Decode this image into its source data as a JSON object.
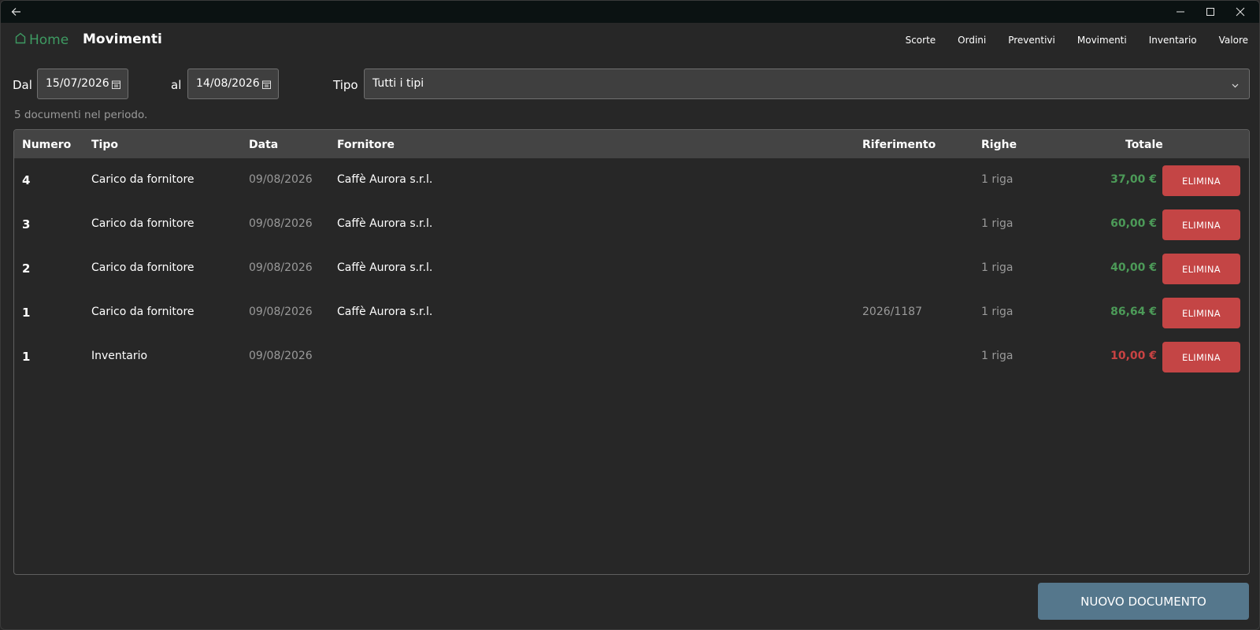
{
  "titlebar": {
    "back_icon": "arrow-left-icon",
    "minimize_icon": "minimize-icon",
    "maximize_icon": "maximize-icon",
    "close_icon": "close-icon"
  },
  "nav": {
    "home_label": "Home",
    "home_icon": "home-icon",
    "page_title": "Movimenti",
    "items": [
      "Scorte",
      "Ordini",
      "Preventivi",
      "Movimenti",
      "Inventario",
      "Valore"
    ]
  },
  "filters": {
    "from_label": "Dal",
    "from_value": "15/07/2026",
    "to_label": "al",
    "to_value": "14/08/2026",
    "type_label": "Tipo",
    "type_value": "Tutti i tipi"
  },
  "summary": "5 documenti nel periodo.",
  "table": {
    "headers": {
      "numero": "Numero",
      "tipo": "Tipo",
      "data": "Data",
      "fornitore": "Fornitore",
      "riferimento": "Riferimento",
      "righe": "Righe",
      "totale": "Totale"
    },
    "delete_label": "ELIMINA",
    "rows": [
      {
        "numero": "4",
        "tipo": "Carico da fornitore",
        "data": "09/08/2026",
        "fornitore": "Caffè Aurora s.r.l.",
        "riferimento": "",
        "righe": "1 riga",
        "totale": "37,00 €",
        "totale_color": "#4c9a58"
      },
      {
        "numero": "3",
        "tipo": "Carico da fornitore",
        "data": "09/08/2026",
        "fornitore": "Caffè Aurora s.r.l.",
        "riferimento": "",
        "righe": "1 riga",
        "totale": "60,00 €",
        "totale_color": "#4c9a58"
      },
      {
        "numero": "2",
        "tipo": "Carico da fornitore",
        "data": "09/08/2026",
        "fornitore": "Caffè Aurora s.r.l.",
        "riferimento": "",
        "righe": "1 riga",
        "totale": "40,00 €",
        "totale_color": "#4c9a58"
      },
      {
        "numero": "1",
        "tipo": "Carico da fornitore",
        "data": "09/08/2026",
        "fornitore": "Caffè Aurora s.r.l.",
        "riferimento": "2026/1187",
        "righe": "1 riga",
        "totale": "86,64 €",
        "totale_color": "#4c9a58"
      },
      {
        "numero": "1",
        "tipo": "Inventario",
        "data": "09/08/2026",
        "fornitore": "",
        "riferimento": "",
        "righe": "1 riga",
        "totale": "10,00 €",
        "totale_color": "#c94343"
      }
    ]
  },
  "actions": {
    "new_document": "NUOVO DOCUMENTO"
  },
  "colors": {
    "accent_green": "#3e9a62",
    "positive": "#4c9a58",
    "negative": "#c94343",
    "delete_button": "#c44545",
    "primary_button": "#55778c"
  }
}
